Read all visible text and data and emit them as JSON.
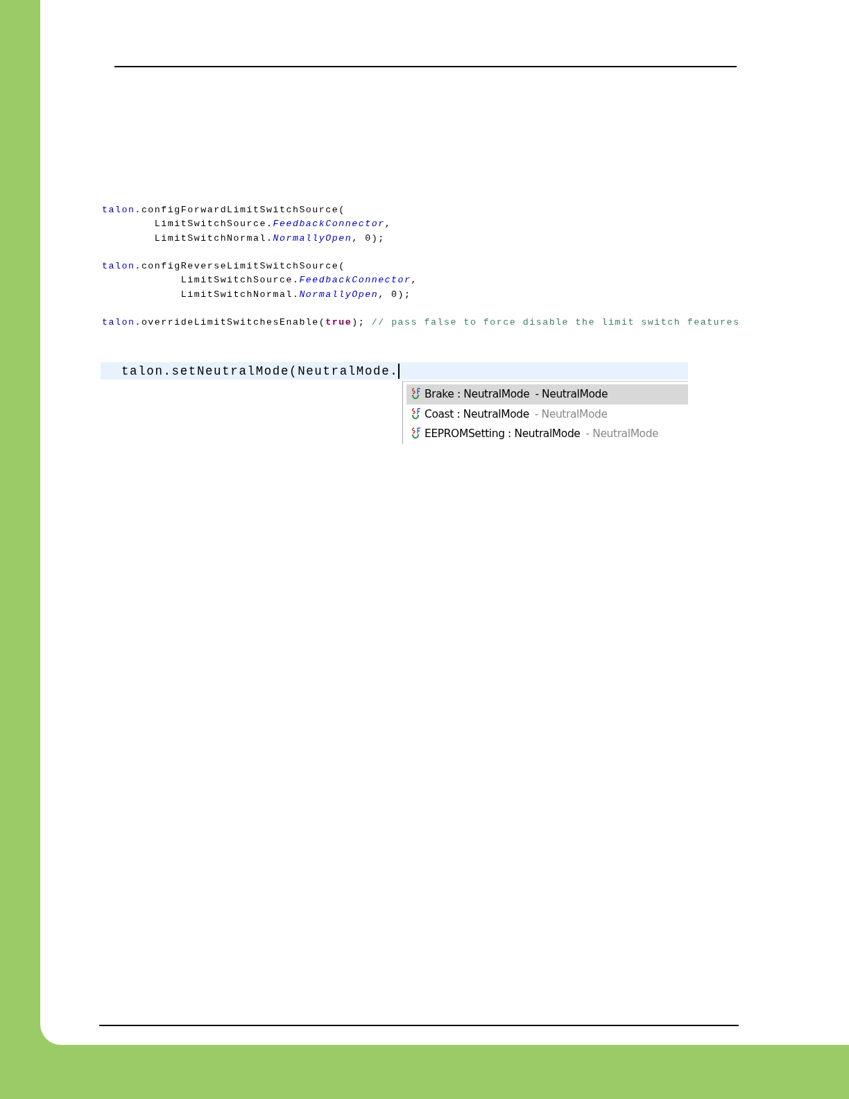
{
  "code_block": {
    "statements": [
      {
        "lines": [
          [
            {
              "kind": "ident",
              "text": "talon"
            },
            {
              "kind": "plain",
              "text": ".configForwardLimitSwitchSource("
            }
          ],
          [
            {
              "kind": "plain",
              "text": "        LimitSwitchSource."
            },
            {
              "kind": "field",
              "text": "FeedbackConnector"
            },
            {
              "kind": "plain",
              "text": ","
            }
          ],
          [
            {
              "kind": "plain",
              "text": "        LimitSwitchNormal."
            },
            {
              "kind": "field",
              "text": "NormallyOpen"
            },
            {
              "kind": "plain",
              "text": ", 0);"
            }
          ]
        ]
      },
      {
        "lines": [
          [
            {
              "kind": "ident",
              "text": "talon"
            },
            {
              "kind": "plain",
              "text": ".configReverseLimitSwitchSource("
            }
          ],
          [
            {
              "kind": "plain",
              "text": "            LimitSwitchSource."
            },
            {
              "kind": "field",
              "text": "FeedbackConnector"
            },
            {
              "kind": "plain",
              "text": ","
            }
          ],
          [
            {
              "kind": "plain",
              "text": "            LimitSwitchNormal."
            },
            {
              "kind": "field",
              "text": "NormallyOpen"
            },
            {
              "kind": "plain",
              "text": ", 0);"
            }
          ]
        ]
      },
      {
        "lines": [
          [
            {
              "kind": "ident",
              "text": "talon"
            },
            {
              "kind": "plain",
              "text": ".overrideLimitSwitchesEnable("
            },
            {
              "kind": "keyword",
              "text": "true"
            },
            {
              "kind": "plain",
              "text": "); "
            },
            {
              "kind": "comment",
              "text": "// pass false to force disable the limit switch features"
            }
          ]
        ]
      }
    ]
  },
  "editor": {
    "line": "talon.setNeutralMode(NeutralMode.",
    "completions": [
      {
        "name": "Brake : NeutralMode",
        "owner": "- NeutralMode",
        "selected": true
      },
      {
        "name": "Coast : NeutralMode",
        "owner": "- NeutralMode",
        "selected": false
      },
      {
        "name": "EEPROMSetting : NeutralMode",
        "owner": "- NeutralMode",
        "selected": false
      }
    ]
  }
}
